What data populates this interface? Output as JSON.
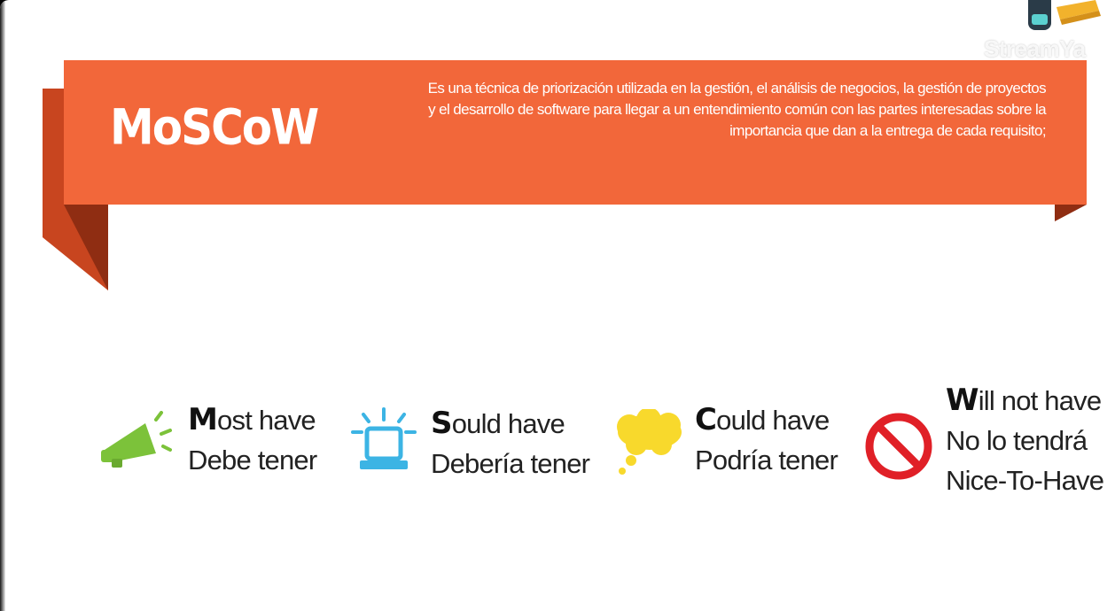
{
  "header": {
    "title": "MoSCoW",
    "description": "Es una técnica de priorización utilizada en la gestión, el análisis de negocios, la gestión de proyectos y el desarrollo de software para llegar a un entendimiento común con las partes interesadas sobre la importancia que dan a la entrega de cada requisito;"
  },
  "watermark": "StreamYa",
  "items": [
    {
      "icon": "megaphone-icon",
      "lead": "M",
      "rest": "ost have",
      "line2": "Debe tener",
      "line3": ""
    },
    {
      "icon": "siren-icon",
      "lead": "S",
      "rest": "ould have",
      "line2": "Debería tener",
      "line3": ""
    },
    {
      "icon": "thought-cloud-icon",
      "lead": "C",
      "rest": "ould have",
      "line2": "Podría tener",
      "line3": ""
    },
    {
      "icon": "prohibited-icon",
      "lead": "W",
      "rest": "ill not have",
      "line2": "No lo tendrá",
      "line3": "Nice-To-Have"
    }
  ],
  "colors": {
    "ribbon": "#f2673a",
    "ribbon_dark": "#a5361a",
    "green": "#7cc23a",
    "blue": "#3cb4e4",
    "yellow": "#f8d92c",
    "red": "#e02027"
  }
}
